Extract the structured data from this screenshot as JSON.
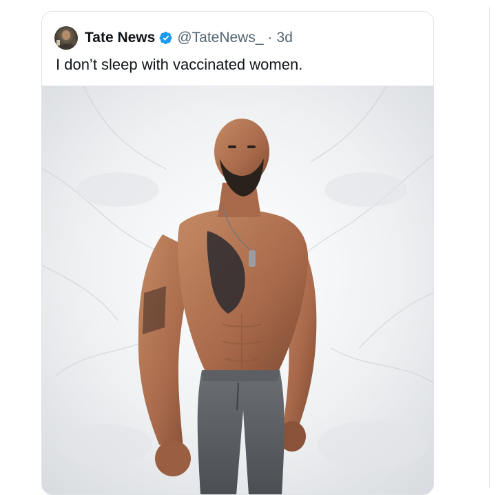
{
  "tweet": {
    "author_name": "Tate News",
    "handle": "@TateNews_",
    "separator": "·",
    "age": "3d",
    "text": "I don’t sleep with vaccinated women.",
    "verified_icon": "verified-badge-icon",
    "avatar": "avatar-photo"
  },
  "media": {
    "description_icon": "photo-shirtless-man-grey-sweatpants",
    "background": "white-grey-marble"
  },
  "colors": {
    "name_text": "#0f1419",
    "meta_text": "#536471",
    "verified_blue": "#1d9bf0",
    "card_border": "#dfe3e8"
  }
}
